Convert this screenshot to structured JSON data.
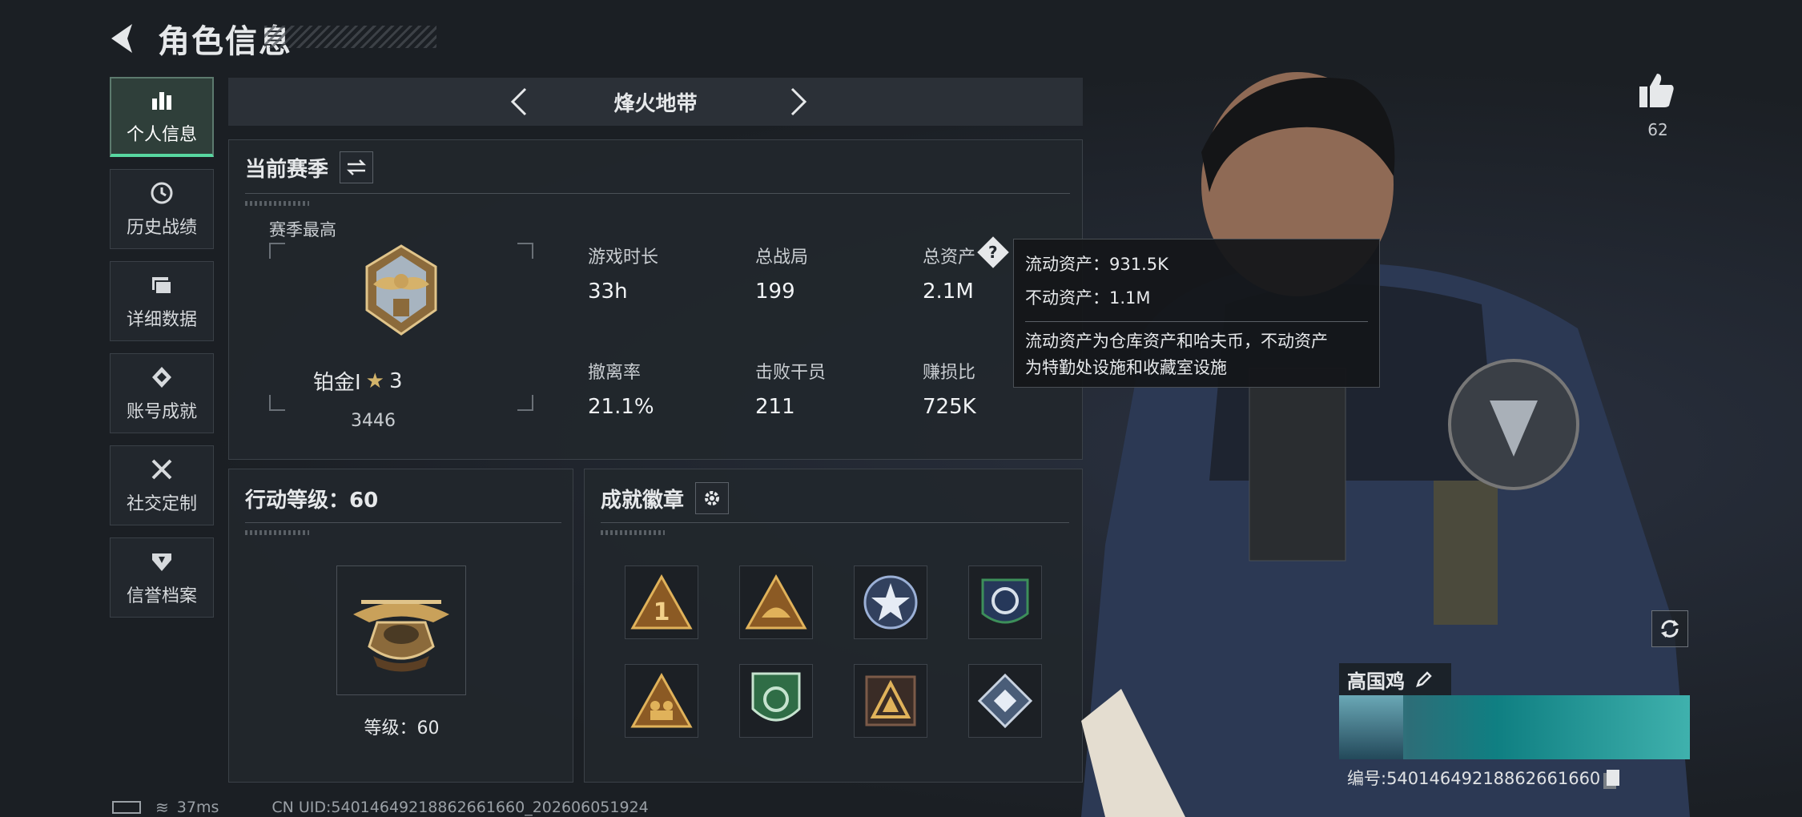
{
  "header": {
    "title": "角色信息"
  },
  "nav": {
    "items": [
      {
        "label": "个人信息",
        "icon": "bar-chart-icon",
        "active": true
      },
      {
        "label": "历史战绩",
        "icon": "history-icon",
        "active": false
      },
      {
        "label": "详细数据",
        "icon": "folder-icon",
        "active": false
      },
      {
        "label": "账号成就",
        "icon": "achievement-icon",
        "active": false
      },
      {
        "label": "社交定制",
        "icon": "tools-icon",
        "active": false
      },
      {
        "label": "信誉档案",
        "icon": "shield-icon",
        "active": false
      }
    ]
  },
  "mode": {
    "name": "烽火地带"
  },
  "season": {
    "title": "当前赛季",
    "best_label": "赛季最高",
    "rank_name": "铂金Ⅰ",
    "rank_stars": "3",
    "rank_score": "3446",
    "stats": [
      {
        "label": "游戏时长",
        "value": "33h"
      },
      {
        "label": "总战局",
        "value": "199"
      },
      {
        "label": "总资产",
        "value": "2.1M"
      },
      {
        "label": "撤离率",
        "value": "21.1%"
      },
      {
        "label": "击败干员",
        "value": "211"
      },
      {
        "label": "赚损比",
        "value": "725K"
      }
    ]
  },
  "tooltip": {
    "liquid": "流动资产：931.5K",
    "fixed": "不动资产：1.1M",
    "desc_line1": "流动资产为仓库资产和哈夫币，不动资产",
    "desc_line2": "为特勤处设施和收藏室设施"
  },
  "action_level": {
    "title": "行动等级：60",
    "level_text": "等级：60"
  },
  "badges": {
    "title": "成就徽章",
    "items": [
      "badge-1",
      "badge-2",
      "badge-3",
      "badge-4",
      "badge-5",
      "badge-6",
      "badge-7",
      "badge-8"
    ]
  },
  "profile": {
    "likes": "62",
    "name": "高国鸡",
    "uid_text": "编号:540146492188626616​60"
  },
  "status": {
    "ping": "37ms",
    "uid_line": "CN UID:5401464921886266166​0_202606051924"
  },
  "colors": {
    "accent": "#58d7a0",
    "gold": "#c9a15a",
    "panel": "#22272d"
  }
}
